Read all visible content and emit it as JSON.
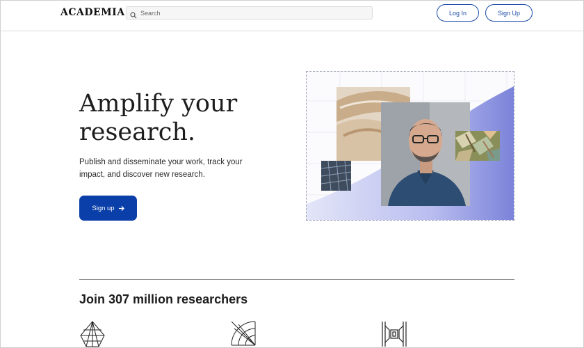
{
  "header": {
    "logo": "ACADEMIA",
    "search_placeholder": "Search",
    "login_label": "Log In",
    "signup_label": "Sign Up"
  },
  "hero": {
    "title_line1": "Amplify your",
    "title_line2": "research.",
    "subtitle_line1": "Publish and disseminate your work, track your",
    "subtitle_line2": "impact, and discover new research.",
    "cta_label": "Sign up"
  },
  "stats": {
    "title": "Join 307 million researchers"
  },
  "colors": {
    "brand_blue": "#0a3ea8",
    "accent_purple": "#7b83d8"
  },
  "icons": [
    "search-icon",
    "arrow-right-icon",
    "globe-grid-icon",
    "radar-icon",
    "maze-icon"
  ]
}
